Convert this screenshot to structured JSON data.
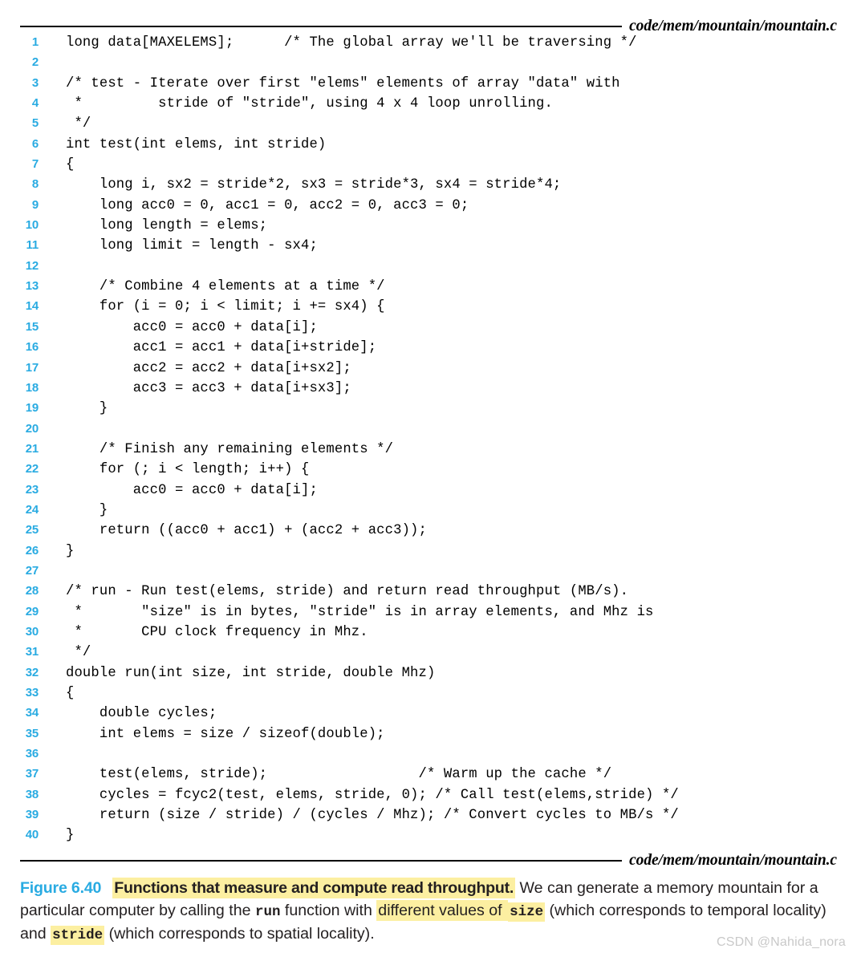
{
  "figure": {
    "source_path_top": "code/mem/mountain/mountain.c",
    "source_path_bottom": "code/mem/mountain/mountain.c",
    "accent_color": "#29ABE2",
    "highlight_color": "#FCEFA1",
    "text_color": "#000000"
  },
  "code": {
    "lines": [
      {
        "n": "1",
        "text": "long data[MAXELEMS];      /* The global array we'll be traversing */"
      },
      {
        "n": "2",
        "text": ""
      },
      {
        "n": "3",
        "text": "/* test - Iterate over first \"elems\" elements of array \"data\" with"
      },
      {
        "n": "4",
        "text": " *         stride of \"stride\", using 4 x 4 loop unrolling."
      },
      {
        "n": "5",
        "text": " */"
      },
      {
        "n": "6",
        "text": "int test(int elems, int stride)"
      },
      {
        "n": "7",
        "text": "{"
      },
      {
        "n": "8",
        "text": "    long i, sx2 = stride*2, sx3 = stride*3, sx4 = stride*4;"
      },
      {
        "n": "9",
        "text": "    long acc0 = 0, acc1 = 0, acc2 = 0, acc3 = 0;"
      },
      {
        "n": "10",
        "text": "    long length = elems;"
      },
      {
        "n": "11",
        "text": "    long limit = length - sx4;"
      },
      {
        "n": "12",
        "text": ""
      },
      {
        "n": "13",
        "text": "    /* Combine 4 elements at a time */"
      },
      {
        "n": "14",
        "text": "    for (i = 0; i < limit; i += sx4) {"
      },
      {
        "n": "15",
        "text": "        acc0 = acc0 + data[i];"
      },
      {
        "n": "16",
        "text": "        acc1 = acc1 + data[i+stride];"
      },
      {
        "n": "17",
        "text": "        acc2 = acc2 + data[i+sx2];"
      },
      {
        "n": "18",
        "text": "        acc3 = acc3 + data[i+sx3];"
      },
      {
        "n": "19",
        "text": "    }"
      },
      {
        "n": "20",
        "text": ""
      },
      {
        "n": "21",
        "text": "    /* Finish any remaining elements */"
      },
      {
        "n": "22",
        "text": "    for (; i < length; i++) {"
      },
      {
        "n": "23",
        "text": "        acc0 = acc0 + data[i];"
      },
      {
        "n": "24",
        "text": "    }"
      },
      {
        "n": "25",
        "text": "    return ((acc0 + acc1) + (acc2 + acc3));"
      },
      {
        "n": "26",
        "text": "}"
      },
      {
        "n": "27",
        "text": ""
      },
      {
        "n": "28",
        "text": "/* run - Run test(elems, stride) and return read throughput (MB/s)."
      },
      {
        "n": "29",
        "text": " *       \"size\" is in bytes, \"stride\" is in array elements, and Mhz is"
      },
      {
        "n": "30",
        "text": " *       CPU clock frequency in Mhz."
      },
      {
        "n": "31",
        "text": " */"
      },
      {
        "n": "32",
        "text": "double run(int size, int stride, double Mhz)"
      },
      {
        "n": "33",
        "text": "{"
      },
      {
        "n": "34",
        "text": "    double cycles;"
      },
      {
        "n": "35",
        "text": "    int elems = size / sizeof(double);"
      },
      {
        "n": "36",
        "text": ""
      },
      {
        "n": "37",
        "text": "    test(elems, stride);                  /* Warm up the cache */"
      },
      {
        "n": "38",
        "text": "    cycles = fcyc2(test, elems, stride, 0); /* Call test(elems,stride) */"
      },
      {
        "n": "39",
        "text": "    return (size / stride) / (cycles / Mhz); /* Convert cycles to MB/s */"
      },
      {
        "n": "40",
        "text": "}"
      }
    ]
  },
  "caption": {
    "figure_number": "Figure 6.40",
    "title_highlighted": "Functions that measure and compute read throughput.",
    "body_part1": " We can generate a memory mountain for a particular computer by calling the ",
    "mono_run": "run",
    "body_part2": " function with ",
    "highlight_phrase": "different values of ",
    "mono_size": "size",
    "body_part3": " (which corresponds to temporal locality) and ",
    "mono_stride": "stride",
    "body_part4": " (which corresponds to spatial locality)."
  },
  "watermark": {
    "text": "CSDN @Nahida_nora"
  }
}
